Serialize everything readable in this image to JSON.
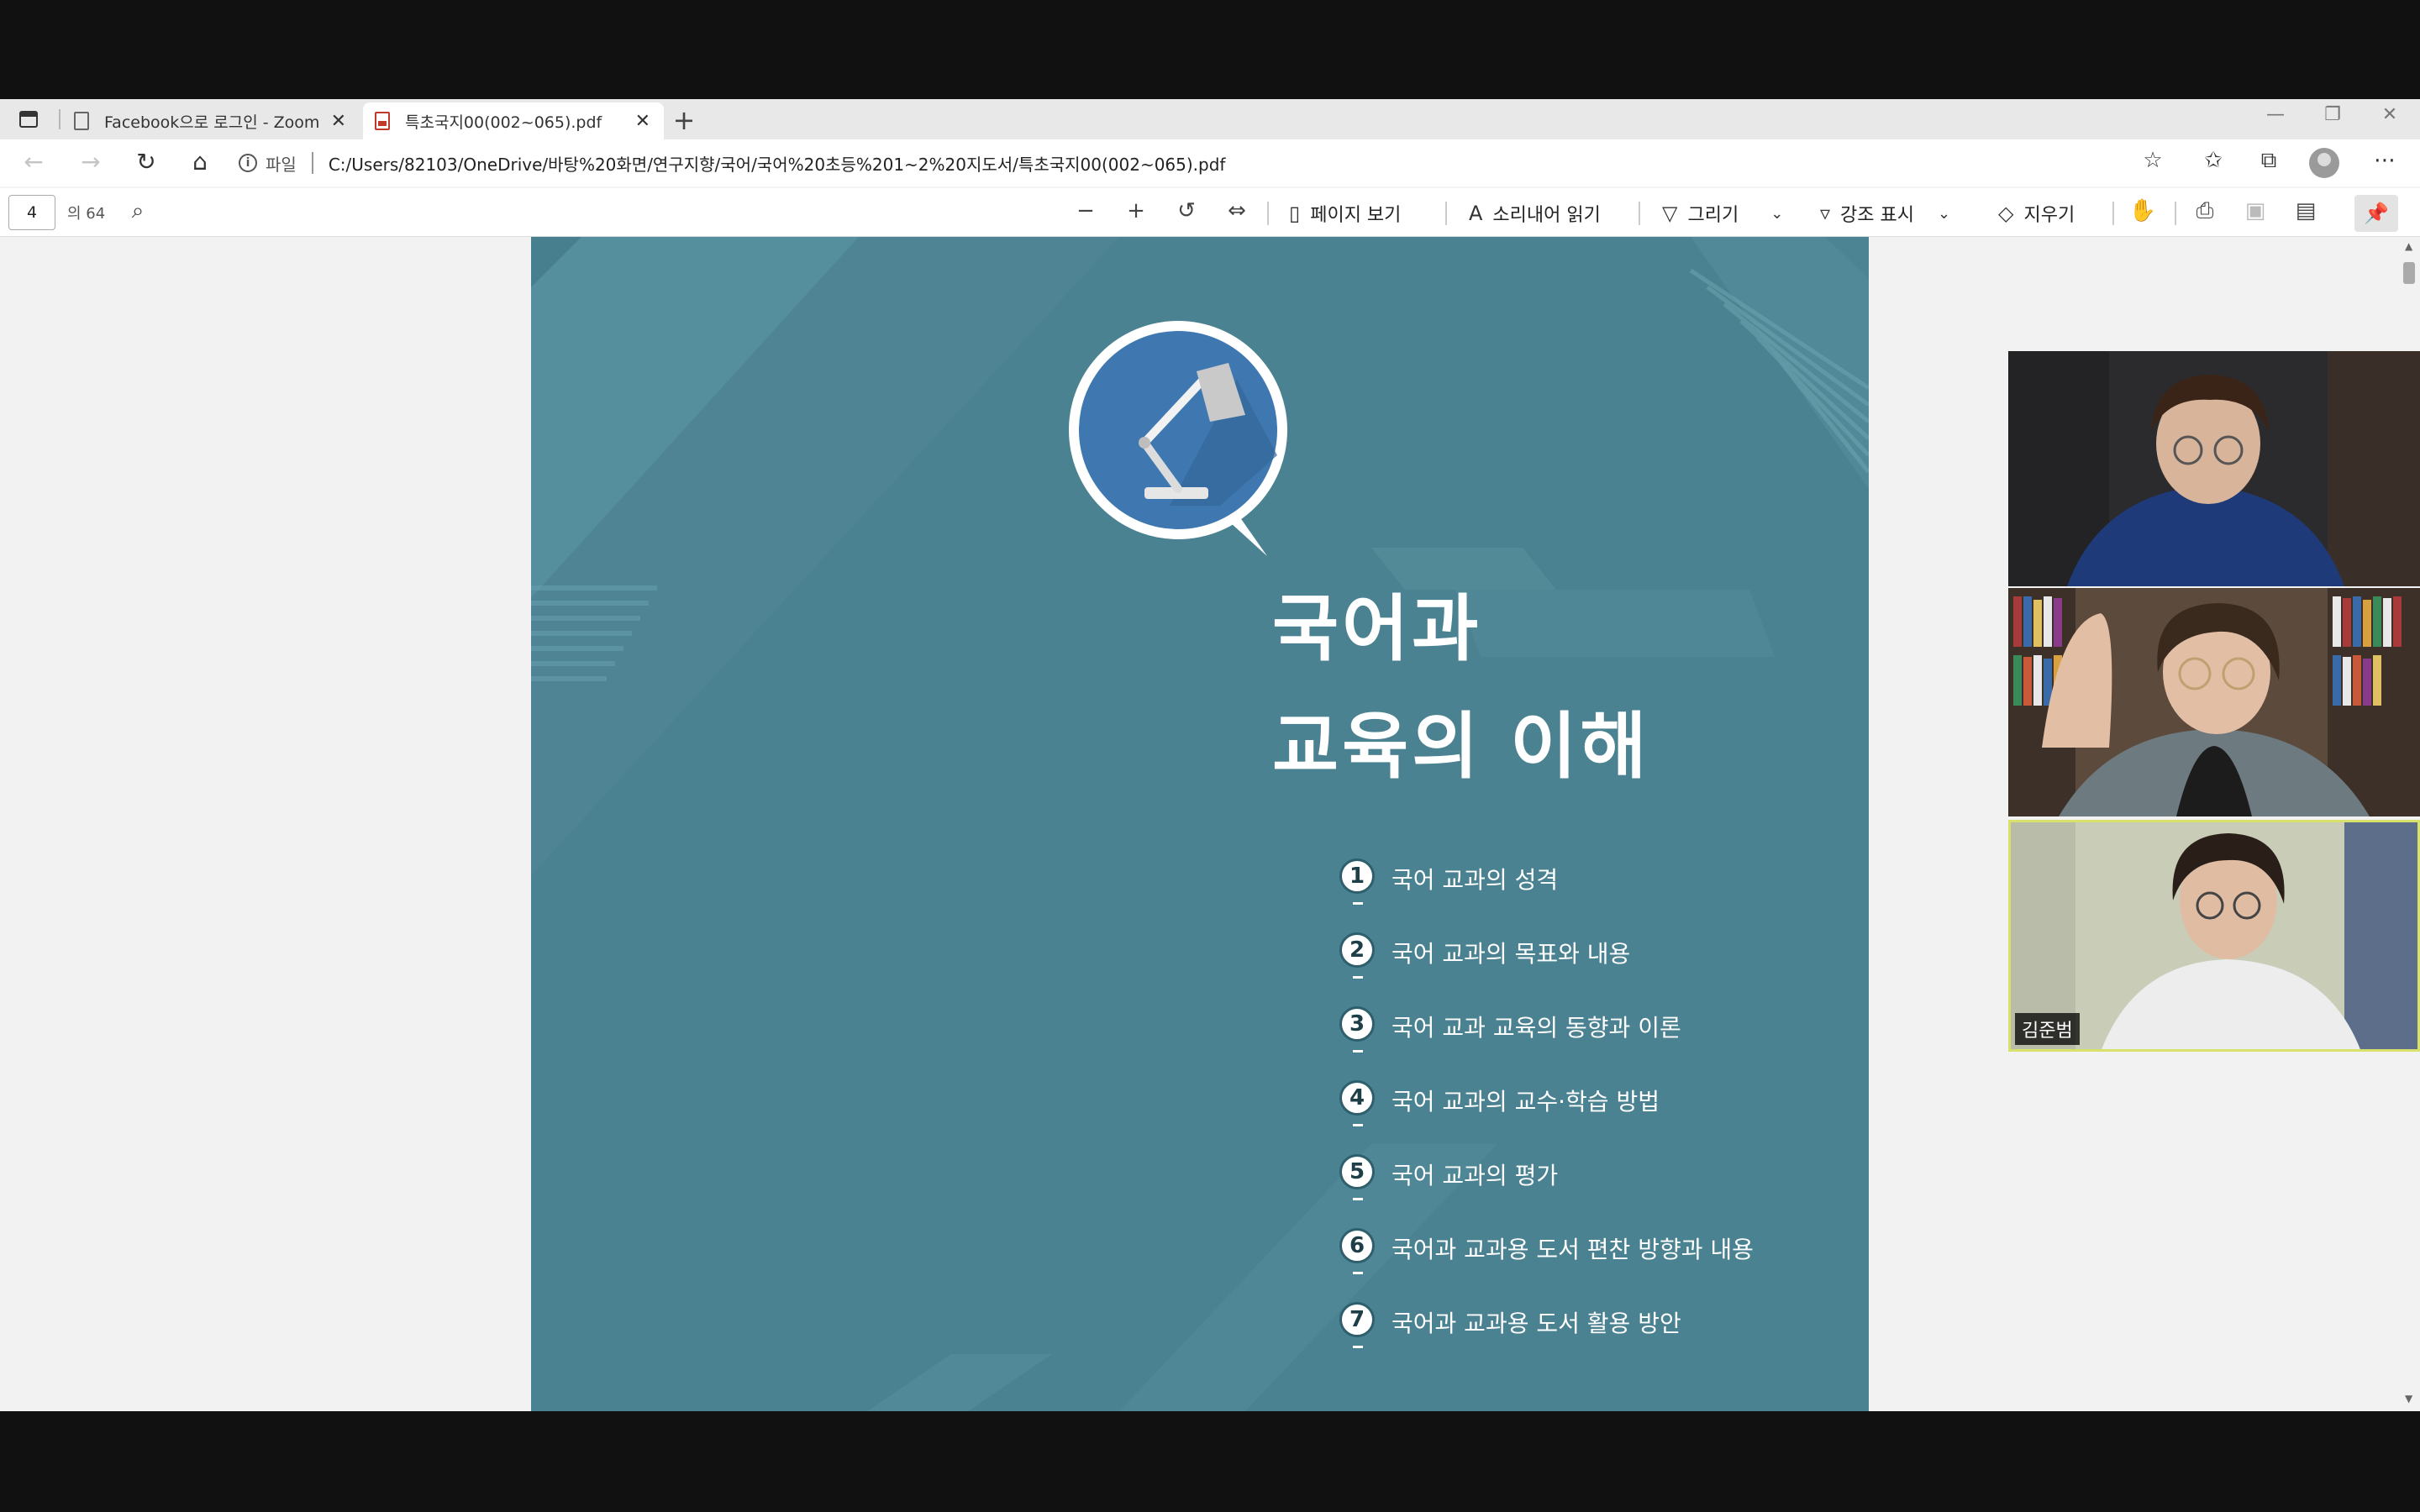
{
  "browser": {
    "tabs": [
      {
        "label": "Facebook으로 로그인 - Zoom",
        "active": false
      },
      {
        "label": "특초국지00(002~065).pdf",
        "active": true
      }
    ],
    "address": {
      "scheme_label": "파일",
      "url": "C:/Users/82103/OneDrive/바탕%20화면/연구지향/국어/국어%20초등%201~2%20지도서/특초국지00(002~065).pdf"
    }
  },
  "pdf_toolbar": {
    "page_number": "4",
    "page_total": "의 64",
    "page_view": "페이지 보기",
    "read_aloud": "소리내어 읽기",
    "draw": "그리기",
    "highlight": "강조 표시",
    "erase": "지우기"
  },
  "document": {
    "title_line1": "국어과",
    "title_line2": "교육의 이해",
    "toc": [
      {
        "num": "1",
        "text": "국어 교과의 성격"
      },
      {
        "num": "2",
        "text": "국어 교과의 목표와 내용"
      },
      {
        "num": "3",
        "text": "국어 교과 교육의 동향과 이론"
      },
      {
        "num": "4",
        "text": "국어 교과의 교수·학습 방법"
      },
      {
        "num": "5",
        "text": "국어 교과의 평가"
      },
      {
        "num": "6",
        "text": "국어과 교과용 도서 편찬 방향과 내용"
      },
      {
        "num": "7",
        "text": "국어과 교과용 도서 활용 방안"
      }
    ]
  },
  "video": {
    "participants": [
      {
        "name": ""
      },
      {
        "name": ""
      },
      {
        "name": "김준범",
        "speaking": true
      }
    ]
  },
  "colors": {
    "page_bg": "#4b8291",
    "lamp_circle": "#3f78b0",
    "speaker_outline": "#d8e26a"
  },
  "icons": [
    "sidebar-icon",
    "page-icon",
    "pdf-icon",
    "close-icon",
    "plus-icon",
    "back-icon",
    "forward-icon",
    "refresh-icon",
    "home-icon",
    "info-icon",
    "favorite-add-icon",
    "favorites-icon",
    "collections-icon",
    "profile-icon",
    "more-icon",
    "search-icon",
    "zoom-out-icon",
    "zoom-in-icon",
    "rotate-icon",
    "fit-icon",
    "page-view-icon",
    "read-aloud-icon",
    "draw-icon",
    "highlight-icon",
    "eraser-icon",
    "touch-icon",
    "print-icon",
    "save-icon",
    "save-as-icon",
    "pin-icon",
    "lamp-icon"
  ]
}
